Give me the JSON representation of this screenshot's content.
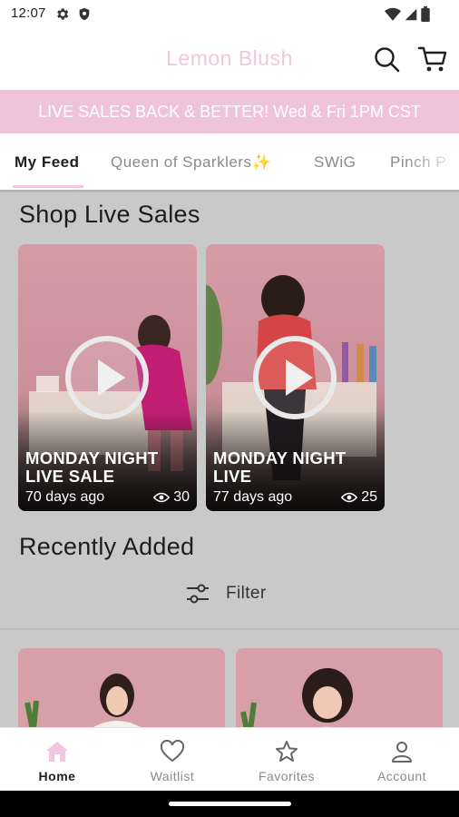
{
  "status_bar": {
    "time": "12:07"
  },
  "header": {
    "title": "Lemon Blush"
  },
  "announcement": "LIVE SALES BACK & BETTER! Wed & Fri 1PM CST",
  "tabs": [
    "My Feed",
    "Queen of Sparklers✨",
    "SWiG",
    "Pinch P"
  ],
  "sections": {
    "live_sales_title": "Shop Live Sales",
    "recently_added_title": "Recently Added"
  },
  "live_sales": [
    {
      "title": "MONDAY NIGHT LIVE SALE",
      "age": "70 days ago",
      "views": "30"
    },
    {
      "title": "MONDAY NIGHT LIVE",
      "age": "77 days ago",
      "views": "25"
    }
  ],
  "filter_label": "Filter",
  "bottom_nav": [
    {
      "label": "Home",
      "icon": "home-icon",
      "active": true
    },
    {
      "label": "Waitlist",
      "icon": "heart-icon",
      "active": false
    },
    {
      "label": "Favorites",
      "icon": "star-icon",
      "active": false
    },
    {
      "label": "Account",
      "icon": "person-icon",
      "active": false
    }
  ],
  "colors": {
    "brand_pink": "#f2c6df",
    "announcement_bg": "#f0c3dc",
    "text_dark": "#1f1f1f",
    "overlay_gray": "#c9c9c9"
  }
}
